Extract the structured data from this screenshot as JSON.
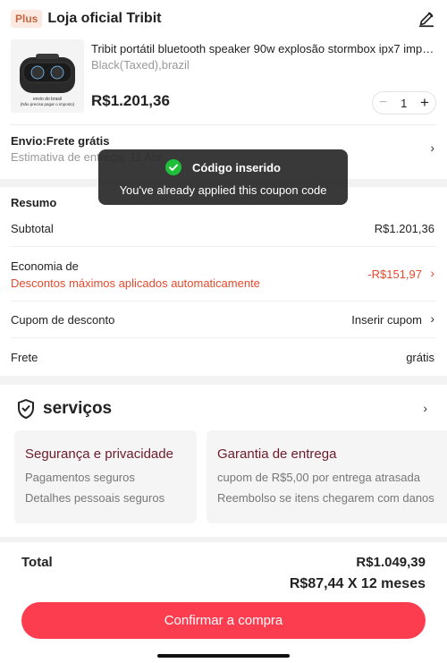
{
  "store": {
    "badge": "Plus",
    "name": "Loja oficial Tribit",
    "product": {
      "title": "Tribit portátil bluetooth speaker 90w explosão stormbox ipx7 imperm...",
      "variant": "Black(Taxed),brazil",
      "price": "R$1.201,36",
      "quantity": "1",
      "image_caption_line1": "envio do brasil",
      "image_caption_line2": "(Não precisa pagar o imposto)"
    },
    "shipping": {
      "title": "Envio:Frete grátis",
      "estimate": "Estimativa de entrega: 11 Abr."
    }
  },
  "summary": {
    "title": "Resumo",
    "subtotal_label": "Subtotal",
    "subtotal_value": "R$1.201,36",
    "savings_label": "Economia de",
    "savings_note": "Descontos máximos aplicados automaticamente",
    "savings_value": "-R$151,97",
    "coupon_label": "Cupom de desconto",
    "coupon_value": "Inserir cupom",
    "freight_label": "Frete",
    "freight_value": "grátis"
  },
  "services": {
    "title": "serviços",
    "cards": [
      {
        "heading": "Segurança e privacidade",
        "lines": [
          "Pagamentos seguros",
          "Detalhes pessoais seguros"
        ]
      },
      {
        "heading": "Garantia de entrega",
        "lines": [
          "cupom de R$5,00 por entrega atrasada",
          "Reembolso se itens chegarem com danos"
        ]
      }
    ]
  },
  "total": {
    "label": "Total",
    "value": "R$1.049,39",
    "installments": "R$87,44 X 12 meses",
    "confirm_label": "Confirmar a compra"
  },
  "toast": {
    "title": "Código inserido",
    "message": "You've already applied this coupon code"
  },
  "colors": {
    "accent": "#fb3d4f",
    "discount_red": "#e44a2d",
    "success_green": "#1fbf3a",
    "service_heading": "#6d1b2c"
  },
  "icons": {
    "edit": "pencil-icon",
    "chevron": "chevron-right-icon",
    "shield": "shield-check-icon",
    "toast": "check-circle-icon"
  }
}
